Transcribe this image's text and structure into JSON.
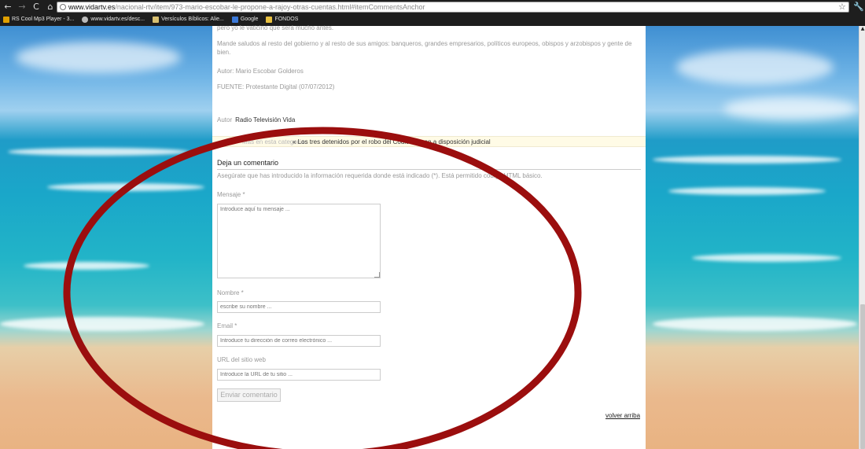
{
  "browser": {
    "url_host": "www.vidartv.es",
    "url_path": "/nacional-rtv/item/973-mario-escobar-le-propone-a-rajoy-otras-cuentas.html#itemCommentsAnchor",
    "nav": {
      "back": "←",
      "forward": "→",
      "reload": "C",
      "home": "⌂"
    },
    "star": "☆",
    "wrench": "🔧",
    "bookmarks": [
      {
        "label": "RS Cool Mp3 Player - 3...",
        "icon": "rs-icon"
      },
      {
        "label": "www.vidartv.es/desc...",
        "icon": "globe-icon"
      },
      {
        "label": "Versículos Bíblicos: Alie...",
        "icon": "bible-icon"
      },
      {
        "label": "Google",
        "icon": "google-icon"
      },
      {
        "label": "FONDOS",
        "icon": "folder-icon"
      }
    ]
  },
  "article": {
    "partial_text": "pero yo le vaticino que será mucho antes.",
    "greeting_text": "Mande saludos al resto del gobierno y al resto de sus amigos: banqueros, grandes empresarios, políticos europeos, obispos y arzobispos y gente de bien.",
    "author_line": "Autor: Mario Escobar Golderos",
    "source_line": "FUENTE: Protestante Digital (07/07/2012)",
    "author_label": "Autor",
    "author_name": "Radio Televisión Vida",
    "category_label": "Más en esta categoría:",
    "prev_item": "« Los tres detenidos por el robo del Códice pasan a disposición judicial"
  },
  "comment_form": {
    "title": "Deja un comentario",
    "hint": "Asegúrate que has introducido la información requerida donde está indicado (*). Está permitido código HTML básico.",
    "message_label": "Mensaje *",
    "message_placeholder": "Introduce aquí tu mensaje ...",
    "name_label": "Nombre *",
    "name_placeholder": "escribe su nombre ...",
    "email_label": "Email *",
    "email_placeholder": "Introduce tu dirección de correo electrónico ...",
    "url_label": "URL del sitio web",
    "url_placeholder": "Introduce la URL de tu sitio ...",
    "submit_label": "Enviar comentario",
    "back_to_top": "volver arriba"
  },
  "colors": {
    "annotation_ring": "#9b0e0e",
    "chrome_dark": "#1e1e1e"
  }
}
